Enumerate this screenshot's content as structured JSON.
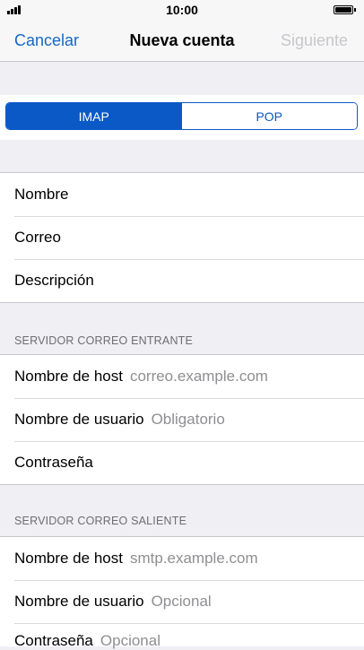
{
  "status": {
    "time": "10:00"
  },
  "nav": {
    "cancel": "Cancelar",
    "title": "Nueva cuenta",
    "next": "Siguiente"
  },
  "segment": {
    "options": [
      "IMAP",
      "POP"
    ],
    "selected": "IMAP"
  },
  "account": {
    "name_label": "Nombre",
    "email_label": "Correo",
    "description_label": "Descripción"
  },
  "incoming": {
    "header": "SERVIDOR CORREO ENTRANTE",
    "host_label": "Nombre de host",
    "host_value": "correo.example.com",
    "user_label": "Nombre de usuario",
    "user_value": "Obligatorio",
    "password_label": "Contraseña"
  },
  "outgoing": {
    "header": "SERVIDOR CORREO SALIENTE",
    "host_label": "Nombre de host",
    "host_value": "smtp.example.com",
    "user_label": "Nombre de usuario",
    "user_value": "Opcional",
    "password_label": "Contraseña",
    "password_value": "Opcional"
  },
  "colors": {
    "accent": "#0a59c6",
    "link": "#1567c8",
    "disabled": "#c7c7cc",
    "placeholder": "#8e8e93"
  }
}
